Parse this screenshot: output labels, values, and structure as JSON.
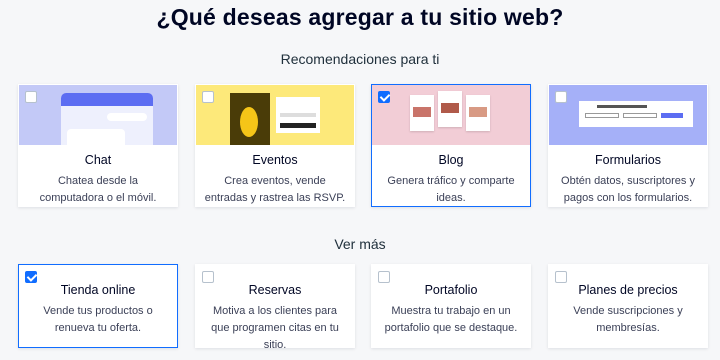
{
  "title": "¿Qué deseas agregar a tu sitio web?",
  "recommendations_label": "Recomendaciones para ti",
  "more_label": "Ver más",
  "recommendations": [
    {
      "name": "Chat",
      "desc": "Chatea desde la computadora o el móvil.",
      "checked": false
    },
    {
      "name": "Eventos",
      "desc": "Crea eventos, vende entradas y rastrea las RSVP.",
      "checked": false
    },
    {
      "name": "Blog",
      "desc": "Genera tráfico y comparte ideas.",
      "checked": true
    },
    {
      "name": "Formularios",
      "desc": "Obtén datos, suscriptores y pagos con los formularios.",
      "checked": false
    }
  ],
  "more": [
    {
      "name": "Tienda online",
      "desc": "Vende tus productos o renueva tu oferta.",
      "checked": true
    },
    {
      "name": "Reservas",
      "desc": "Motiva a los clientes para que programen citas en tu sitio.",
      "checked": false
    },
    {
      "name": "Portafolio",
      "desc": "Muestra tu trabajo en un portafolio que se destaque.",
      "checked": false
    },
    {
      "name": "Planes de precios",
      "desc": "Vende suscripciones y membresías.",
      "checked": false
    }
  ],
  "colors": {
    "accent": "#116dff",
    "background": "#f6f7f9"
  }
}
